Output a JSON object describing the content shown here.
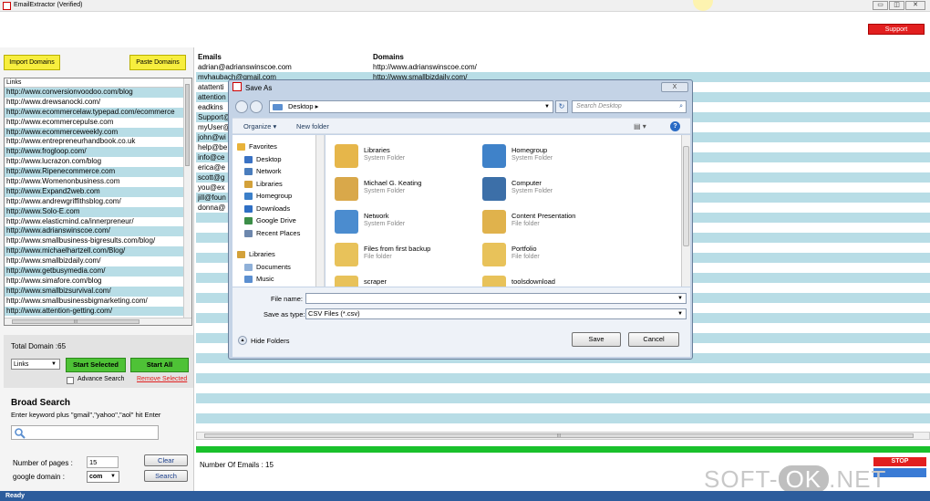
{
  "app": {
    "title": "EmailExtractor  (Verified)",
    "support_label": "Support"
  },
  "left": {
    "import_label": "Import Domains",
    "paste_label": "Paste Domains",
    "list_header": "Links",
    "links": [
      "http://www.conversionvoodoo.com/blog",
      "http://www.drewsanocki.com/",
      "http://www.ecommercelaw.typepad.com/ecommerce",
      "http://www.ecommercepulse.com",
      "http://www.ecommerceweekly.com",
      "http://www.entrepreneurhandbook.co.uk",
      "http://www.frogloop.com/",
      "http://www.lucrazon.com/blog",
      "http://www.Ripenecommerce.com",
      "http://www.Womenonbusiness.com",
      "http://www.Expand2web.com",
      "http://www.andrewgriffithsblog.com/",
      "http://www.Solo-E.com",
      "http://www.elasticmind.ca/innerpreneur/",
      "http://www.adrianswinscoe.com/",
      "http://www.smallbusiness-bigresults.com/blog/",
      "http://www.michaelhartzell.com/Blog/",
      "http://www.smallbizdaily.com/",
      "http://www.getbusymedia.com/",
      "http://www.simafore.com/blog",
      "http://www.smallbizsurvival.com/",
      "http://www.smallbusinessbigmarketing.com/",
      "http://www.attention-getting.com/"
    ],
    "hscroll_grip": "III",
    "total_domain": "Total Domain :65",
    "mode_select": "Links",
    "start_selected_label": "Start Selected",
    "start_all_label": "Start All",
    "advance_search_label": "Advance Search",
    "remove_selected_label": "Remove Selected",
    "broad_search_title": "Broad Search",
    "broad_search_desc": "Enter keyword plus \"gmail\",\"yahoo\",\"aol\" hit Enter",
    "pages_label": "Number of pages :",
    "pages_value": "15",
    "clear_label": "Clear",
    "google_domain_label": "google domain   :",
    "google_domain_value": "com",
    "search_label": "Search"
  },
  "grid": {
    "col_emails": "Emails",
    "col_domains": "Domains",
    "rows": [
      {
        "email": "adrian@adrianswinscoe.com",
        "domain": "http://www.adrianswinscoe.com/"
      },
      {
        "email": "mvhaubach@gmail.com",
        "domain": "http://www.smallbizdaily.com/"
      },
      {
        "email": "atattenti",
        "domain": ""
      },
      {
        "email": "attention",
        "domain": ""
      },
      {
        "email": "eadkins",
        "domain": ""
      },
      {
        "email": "Support@",
        "domain": ""
      },
      {
        "email": "myUser@",
        "domain": ""
      },
      {
        "email": "john@wi",
        "domain": ""
      },
      {
        "email": "help@be",
        "domain": ""
      },
      {
        "email": "info@ce",
        "domain": ""
      },
      {
        "email": "erica@e",
        "domain": ""
      },
      {
        "email": "scott@g",
        "domain": ""
      },
      {
        "email": "you@ex",
        "domain": ""
      },
      {
        "email": "jill@foun",
        "domain": ""
      },
      {
        "email": "donna@",
        "domain": ""
      }
    ],
    "hscroll_grip": "III",
    "emails_count": "Number Of Emails : 15",
    "stop_label": "STOP"
  },
  "status": {
    "text": "Ready"
  },
  "watermark": {
    "soft": "SOFT-",
    "ok": "OK",
    "net": ".NET"
  },
  "dialog": {
    "title": "Save As",
    "close_label": "X",
    "path_root": "Desktop",
    "search_placeholder": "Search Desktop",
    "organize_label": "Organize ▾",
    "new_folder_label": "New folder",
    "nav": [
      "Favorites",
      "Desktop",
      "Network",
      "Libraries",
      "Homegroup",
      "Downloads",
      "Google Drive",
      "Recent Places"
    ],
    "nav2": [
      "Libraries",
      "Documents",
      "Music"
    ],
    "files": [
      {
        "name": "Libraries",
        "type": "System Folder"
      },
      {
        "name": "Homegroup",
        "type": "System Folder"
      },
      {
        "name": "Michael G. Keating",
        "type": "System Folder"
      },
      {
        "name": "Computer",
        "type": "System Folder"
      },
      {
        "name": "Network",
        "type": "System Folder"
      },
      {
        "name": "Content Presentation",
        "type": "File folder"
      },
      {
        "name": "Files from first backup",
        "type": "File folder"
      },
      {
        "name": "Portfolio",
        "type": "File folder"
      },
      {
        "name": "scraper",
        "type": ""
      },
      {
        "name": "toolsdownload",
        "type": ""
      }
    ],
    "file_name_label": "File name:",
    "file_name_value": "",
    "save_type_label": "Save as type:",
    "save_type_value": "CSV Files (*.csv)",
    "hide_folders_label": "Hide Folders",
    "save_label": "Save",
    "cancel_label": "Cancel"
  },
  "colors": {
    "stripe": "#b8dde6",
    "green": "#4ec236",
    "yellow": "#f7ee3e",
    "red": "#e21f1f",
    "status_blue": "#2c5c9c"
  }
}
